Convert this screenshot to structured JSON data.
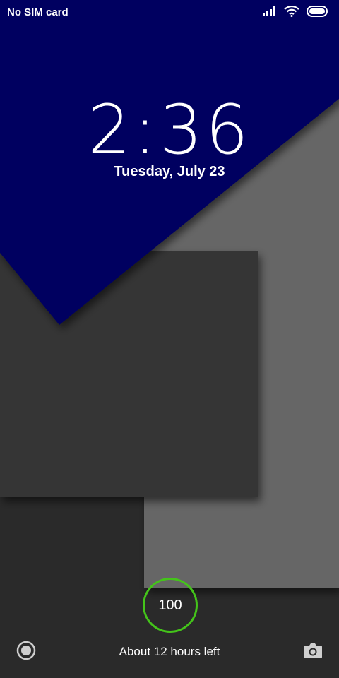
{
  "status_bar": {
    "carrier": "No SIM card",
    "icons": [
      "signal-icon",
      "wifi-icon",
      "battery-icon"
    ]
  },
  "lock": {
    "time": "2:36",
    "date": "Tuesday, July 23"
  },
  "battery": {
    "level": "100",
    "ring_color": "#44c41a"
  },
  "footer": {
    "hint": "About 12 hours left",
    "left_icon": "record-icon",
    "right_icon": "camera-icon"
  },
  "colors": {
    "navy": "#030560",
    "dark_card": "#343434",
    "light_card": "#666666",
    "background": "#2a2a2a"
  }
}
